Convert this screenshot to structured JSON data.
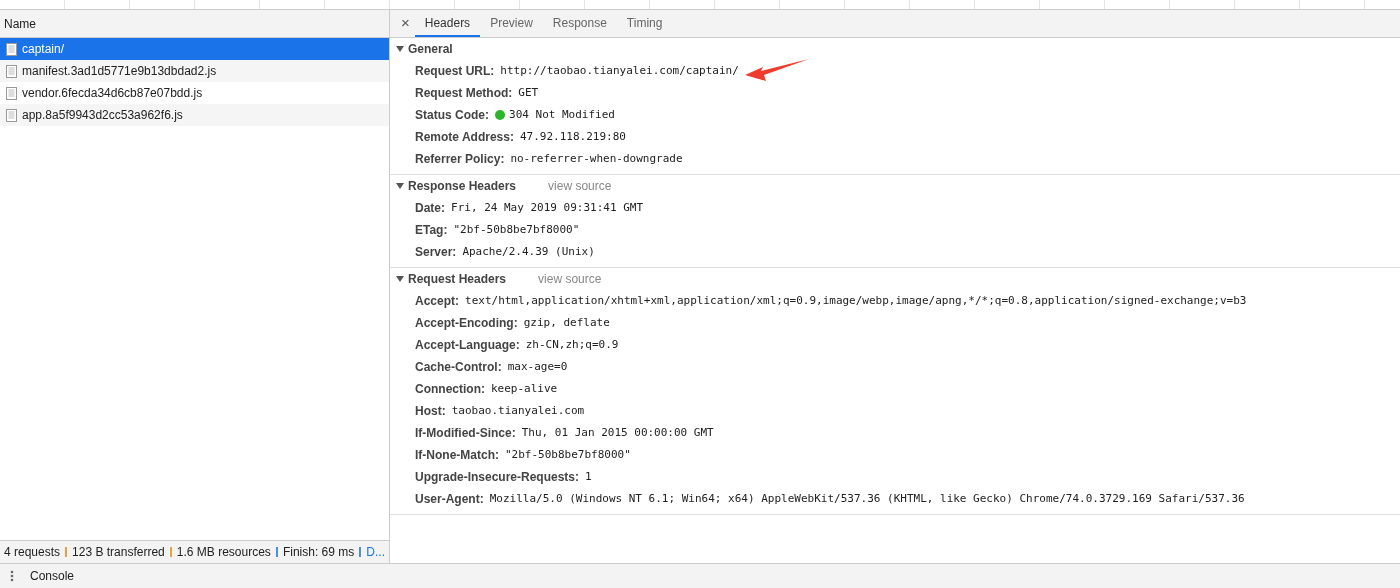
{
  "requests": {
    "column": "Name",
    "items": [
      {
        "name": "captain/",
        "selected": true
      },
      {
        "name": "manifest.3ad1d5771e9b13dbdad2.js",
        "selected": false
      },
      {
        "name": "vendor.6fecda34d6cb87e07bdd.js",
        "selected": false
      },
      {
        "name": "app.8a5f9943d2cc53a962f6.js",
        "selected": false
      }
    ]
  },
  "summary": [
    {
      "text": "4 requests",
      "color": "#e8a33d"
    },
    {
      "text": "123 B transferred",
      "color": "#e8a33d"
    },
    {
      "text": "1.6 MB resources",
      "color": "#4a90d9"
    },
    {
      "text": "Finish: 69 ms",
      "color": "#4a90d9"
    },
    {
      "text": "D...",
      "link": true
    }
  ],
  "drawer": {
    "tab": "Console"
  },
  "details": {
    "close": "×",
    "tabs": [
      {
        "label": "Headers",
        "selected": true
      },
      {
        "label": "Preview",
        "selected": false
      },
      {
        "label": "Response",
        "selected": false
      },
      {
        "label": "Timing",
        "selected": false
      }
    ],
    "sections": [
      {
        "title": "General",
        "expanded": true,
        "items": [
          {
            "kind": "plain",
            "name": "Request URL:",
            "value": "http://taobao.tianyalei.com/captain/",
            "annotated": true
          },
          {
            "kind": "plain",
            "name": "Request Method:",
            "value": "GET"
          },
          {
            "kind": "status",
            "name": "Status Code:",
            "value": "304 Not Modified"
          },
          {
            "kind": "plain",
            "name": "Remote Address:",
            "value": "47.92.118.219:80"
          },
          {
            "kind": "plain",
            "name": "Referrer Policy:",
            "value": "no-referrer-when-downgrade"
          }
        ]
      },
      {
        "title": "Response Headers",
        "link": "view source",
        "expanded": true,
        "items": [
          {
            "kind": "plain",
            "name": "Date:",
            "value": "Fri, 24 May 2019 09:31:41 GMT"
          },
          {
            "kind": "plain",
            "name": "ETag:",
            "value": "\"2bf-50b8be7bf8000\""
          },
          {
            "kind": "plain",
            "name": "Server:",
            "value": "Apache/2.4.39 (Unix)"
          }
        ]
      },
      {
        "title": "Request Headers",
        "link": "view source",
        "expanded": true,
        "items": [
          {
            "kind": "plain",
            "name": "Accept:",
            "value": "text/html,application/xhtml+xml,application/xml;q=0.9,image/webp,image/apng,*/*;q=0.8,application/signed-exchange;v=b3"
          },
          {
            "kind": "plain",
            "name": "Accept-Encoding:",
            "value": "gzip, deflate"
          },
          {
            "kind": "plain",
            "name": "Accept-Language:",
            "value": "zh-CN,zh;q=0.9"
          },
          {
            "kind": "plain",
            "name": "Cache-Control:",
            "value": "max-age=0"
          },
          {
            "kind": "plain",
            "name": "Connection:",
            "value": "keep-alive"
          },
          {
            "kind": "plain",
            "name": "Host:",
            "value": "taobao.tianyalei.com"
          },
          {
            "kind": "plain",
            "name": "If-Modified-Since:",
            "value": "Thu, 01 Jan 2015 00:00:00 GMT"
          },
          {
            "kind": "plain",
            "name": "If-None-Match:",
            "value": "\"2bf-50b8be7bf8000\""
          },
          {
            "kind": "plain",
            "name": "Upgrade-Insecure-Requests:",
            "value": "1"
          },
          {
            "kind": "plain",
            "name": "User-Agent:",
            "value": "Mozilla/5.0 (Windows NT 6.1; Win64; x64) AppleWebKit/537.36 (KHTML, like Gecko) Chrome/74.0.3729.169 Safari/537.36"
          }
        ]
      }
    ]
  }
}
